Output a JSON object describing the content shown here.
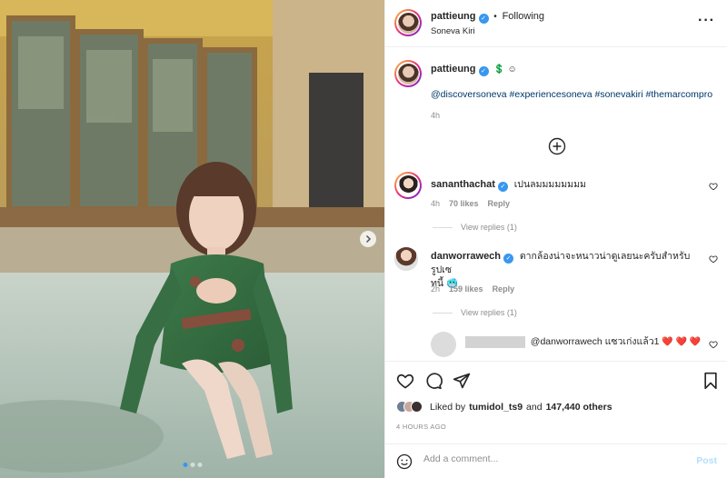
{
  "post": {
    "username": "pattieung",
    "location": "Soneva Kiri",
    "follow_status": "Following",
    "more_icon": "more-horizontal-icon"
  },
  "caption": {
    "username": "pattieung",
    "emojis": "💲 ☺",
    "hashtags": "@discoversoneva #experiencesoneva #sonevakiri #themarcompro",
    "time": "4h"
  },
  "comments": [
    {
      "username": "sananthachat",
      "text": "เปนลมมมมมมมม",
      "time": "4h",
      "likes": "70 likes",
      "reply_label": "Reply",
      "view_replies": "View replies (1)"
    },
    {
      "username": "danworrawech",
      "text": "ตากล้องน่าจะหนาวน่าดูเลยนะครับสำหรับรูปเซ",
      "text2": "ทนี้ 🥶",
      "time": "2h",
      "likes": "159 likes",
      "reply_label": "Reply",
      "view_replies": "View replies (1)"
    }
  ],
  "reply": {
    "text": "@danworrawech แซวเก่งแล้ว1 ",
    "hearts": "❤️ ❤️ ❤️"
  },
  "load_more_icon": "plus-circle-icon",
  "likes_line": {
    "prefix": "Liked by",
    "user": "tumidol_ts9",
    "and": "and",
    "others": "147,440 others"
  },
  "timestamp": "4 HOURS AGO",
  "comment_box": {
    "placeholder": "Add a comment...",
    "post_label": "Post"
  },
  "photo": {
    "carousel_count": 3,
    "active_index": 0
  },
  "colors": {
    "verified": "#3897f0",
    "link": "#00376b",
    "muted": "#8e8e8e",
    "heart": "#ed4956"
  }
}
